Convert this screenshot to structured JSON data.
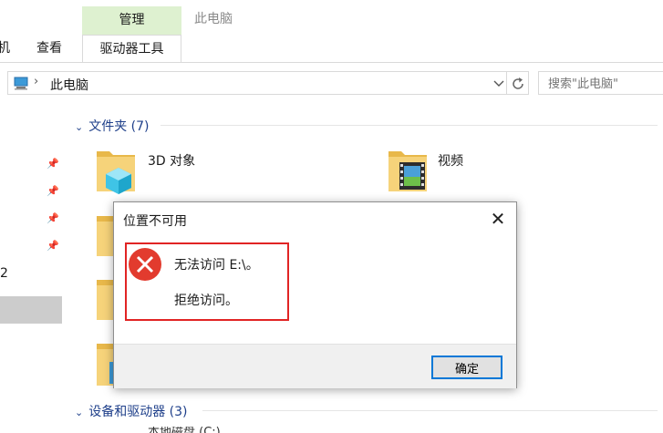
{
  "ribbon": {
    "context_group_label": "管理",
    "window_title": "此电脑",
    "tabs": {
      "partial_left": "机",
      "view": "查看",
      "drive_tools": "驱动器工具"
    }
  },
  "address_bar": {
    "path": "此电脑",
    "separator": "›",
    "dropdown_icon": "chevron-down-icon",
    "refresh_icon": "refresh-icon"
  },
  "search": {
    "placeholder": "搜索\"此电脑\""
  },
  "nav_pane": {
    "partial_label": "2"
  },
  "sections": {
    "folders": {
      "label": "文件夹 (7)"
    },
    "devices": {
      "label": "设备和驱动器 (3)",
      "partial_next": "本地磁盘 (C:)"
    }
  },
  "folders": [
    {
      "label": "3D 对象"
    },
    {
      "label": "视频"
    }
  ],
  "dialog": {
    "title": "位置不可用",
    "message_line1": "无法访问 E:\\。",
    "message_line2": "拒绝访问。",
    "ok_label": "确定",
    "close_glyph": "✕",
    "icon": "error-icon"
  },
  "colors": {
    "context_tab_bg": "#def1d0",
    "section_header": "#1e3f8a",
    "error_red": "#e23b2e",
    "highlight_border": "#e12424",
    "button_border": "#0078d7"
  }
}
